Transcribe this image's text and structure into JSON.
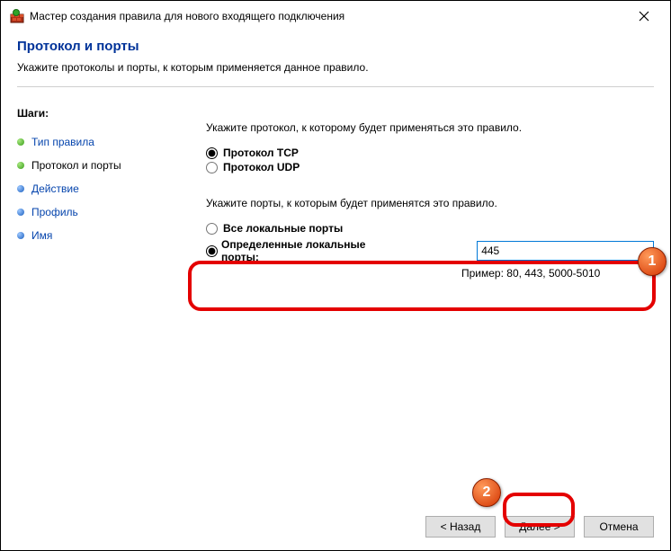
{
  "titlebar": {
    "title": "Мастер создания правила для нового входящего подключения"
  },
  "header": {
    "title": "Протокол и порты",
    "subtitle": "Укажите протоколы и порты, к которым применяется данное правило."
  },
  "stepsTitle": "Шаги:",
  "steps": [
    {
      "label": "Тип правила",
      "state": "done"
    },
    {
      "label": "Протокол и порты",
      "state": "current"
    },
    {
      "label": "Действие",
      "state": "todo"
    },
    {
      "label": "Профиль",
      "state": "todo"
    },
    {
      "label": "Имя",
      "state": "todo"
    }
  ],
  "content": {
    "protocolInstruction": "Укажите протокол, к которому будет применяться это правило.",
    "tcpLabel": "Протокол TCP",
    "udpLabel": "Протокол UDP",
    "portsInstruction": "Укажите порты, к которым будет применятся это правило.",
    "allPortsLabel": "Все локальные порты",
    "specificPortsLabel": "Определенные локальные порты:",
    "portValue": "445",
    "exampleText": "Пример: 80, 443, 5000-5010"
  },
  "footer": {
    "back": "< Назад",
    "next": "Далее >",
    "cancel": "Отмена"
  },
  "annotations": {
    "badge1": "1",
    "badge2": "2"
  }
}
